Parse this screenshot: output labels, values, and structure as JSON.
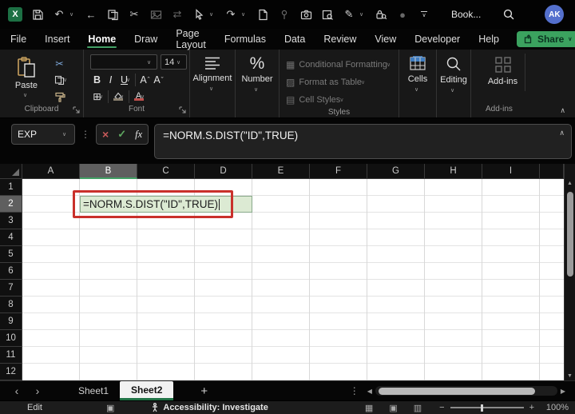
{
  "colors": {
    "accent_green": "#217346",
    "tab_underline_green": "#43a065",
    "share_button_green": "#3ba25f",
    "annotation_red": "#c9302b",
    "active_cell_fill": "#dcead3",
    "avatar_blue": "#5470cd"
  },
  "titlebar": {
    "app_letter": "X",
    "workbook_title": "Book...",
    "avatar_initials": "AK"
  },
  "tabs": {
    "items": [
      "File",
      "Insert",
      "Home",
      "Draw",
      "Page Layout",
      "Formulas",
      "Data",
      "Review",
      "View",
      "Developer",
      "Help"
    ],
    "active": "Home",
    "share_label": "Share"
  },
  "ribbon": {
    "paste_label": "Paste",
    "clipboard_group_label": "Clipboard",
    "font_group_label": "Font",
    "font_size_value": "14",
    "bold_label": "B",
    "italic_label": "I",
    "underline_label": "U",
    "grow_font_label": "A",
    "shrink_font_label": "A",
    "alignment_label": "Alignment",
    "number_label": "Number",
    "styles": {
      "conditional_formatting": "Conditional Formatting",
      "format_as_table": "Format as Table",
      "cell_styles": "Cell Styles",
      "group_label": "Styles"
    },
    "cells_label": "Cells",
    "editing_label": "Editing",
    "addins_label": "Add-ins",
    "addins_group_label": "Add-ins"
  },
  "formula_bar": {
    "name_box_value": "EXP",
    "fx_label": "fx",
    "formula": "=NORM.S.DIST(\"ID\",TRUE)"
  },
  "sheet": {
    "columns": [
      "A",
      "B",
      "C",
      "D",
      "E",
      "F",
      "G",
      "H",
      "I"
    ],
    "rows": [
      "1",
      "2",
      "3",
      "4",
      "5",
      "6",
      "7",
      "8",
      "9",
      "10",
      "11",
      "12"
    ],
    "selected_column": "B",
    "selected_row": "2",
    "active_cell_ref": "B2",
    "active_cell_text": "=NORM.S.DIST(\"ID\",TRUE)"
  },
  "sheetbar": {
    "sheet1": "Sheet1",
    "sheet2": "Sheet2",
    "active": "Sheet2",
    "add_label": "+"
  },
  "statusbar": {
    "mode": "Edit",
    "accessibility": "Accessibility: Investigate",
    "zoom_minus": "−",
    "zoom_plus": "+",
    "zoom_level": "100%"
  },
  "glyphs": {
    "dropdown": "∨",
    "collapse": "∧",
    "back": "←",
    "undo": "↶",
    "redo": "↷",
    "translate": "⇄",
    "scissors": "✂",
    "record": "●",
    "pen": "✎",
    "close": "×",
    "dots": "⋮",
    "check": "✓",
    "caret_up": "ˆ",
    "caret_down": "ˇ",
    "borders": "⊞",
    "align": "≡",
    "percent": "%",
    "grid_a": "▦",
    "grid_b": "▨",
    "grid_c": "▤",
    "nav_left": "‹",
    "nav_right": "›",
    "scroll_left": "◀",
    "scroll_right": "▶",
    "scroll_up": "▲",
    "scroll_down": "▼",
    "view_normal": "▦",
    "view_layout": "▣",
    "view_break": "▥",
    "macro": "▣"
  }
}
